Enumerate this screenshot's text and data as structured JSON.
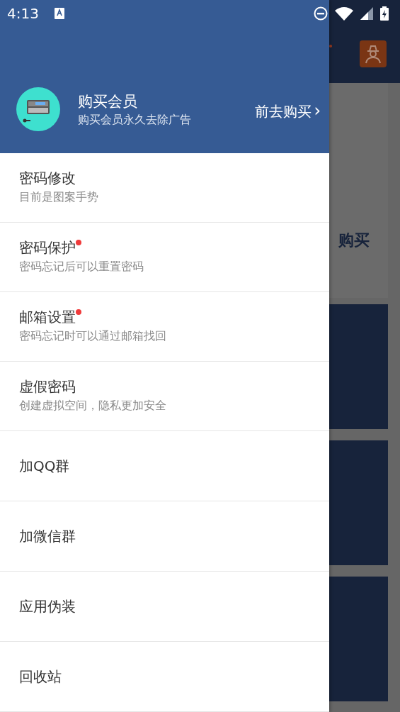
{
  "status_bar": {
    "time": "4:13"
  },
  "header": {
    "title": "购买会员",
    "subtitle": "购买会员永久去除广告",
    "action": "前去购买",
    "action_arrow": "›"
  },
  "menu": [
    {
      "title": "密码修改",
      "subtitle": "目前是图案手势",
      "badge": false
    },
    {
      "title": "密码保护",
      "subtitle": "密码忘记后可以重置密码",
      "badge": true
    },
    {
      "title": "邮箱设置",
      "subtitle": "密码忘记时可以通过邮箱找回",
      "badge": true
    },
    {
      "title": "虚假密码",
      "subtitle": "创建虚拟空间，隐私更加安全",
      "badge": false
    },
    {
      "title": "加QQ群",
      "badge": false
    },
    {
      "title": "加微信群",
      "badge": false
    },
    {
      "title": "应用伪装",
      "badge": false
    },
    {
      "title": "回收站",
      "badge": false
    }
  ],
  "background": {
    "text": "购买"
  }
}
